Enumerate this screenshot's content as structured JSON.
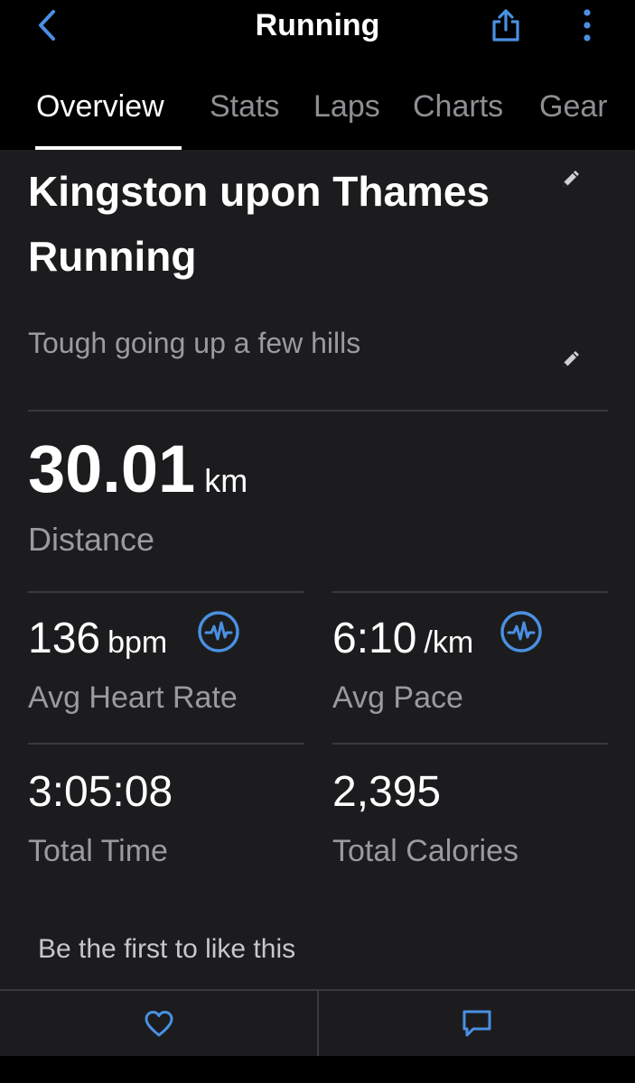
{
  "header": {
    "title": "Running",
    "tabs": [
      {
        "label": "Overview",
        "active": true
      },
      {
        "label": "Stats",
        "active": false
      },
      {
        "label": "Laps",
        "active": false
      },
      {
        "label": "Charts",
        "active": false
      },
      {
        "label": "Gear",
        "active": false
      }
    ]
  },
  "activity": {
    "title": "Kingston upon Thames Running",
    "description": "Tough going up a few hills"
  },
  "distance": {
    "value": "30.01",
    "unit": "km",
    "label": "Distance"
  },
  "stats": [
    {
      "value": "136",
      "unit": "bpm",
      "label": "Avg Heart Rate",
      "chart": true
    },
    {
      "value": "6:10",
      "unit": "/km",
      "label": "Avg Pace",
      "chart": true
    },
    {
      "value": "3:05:08",
      "unit": "",
      "label": "Total Time",
      "chart": false
    },
    {
      "value": "2,395",
      "unit": "",
      "label": "Total Calories",
      "chart": false
    }
  ],
  "social": {
    "likes_text": "Be the first to like this"
  },
  "colors": {
    "accent": "#4a90e2",
    "background": "#000000",
    "card": "#1c1c1e",
    "secondary_text": "#9a9aa0",
    "divider": "#3a3a3c"
  },
  "icons": {
    "back": "chevron-left-icon",
    "share": "share-icon",
    "more": "more-vertical-icon",
    "edit": "pencil-icon",
    "chart": "heartbeat-chart-icon",
    "like": "heart-icon",
    "comment": "comment-icon"
  }
}
